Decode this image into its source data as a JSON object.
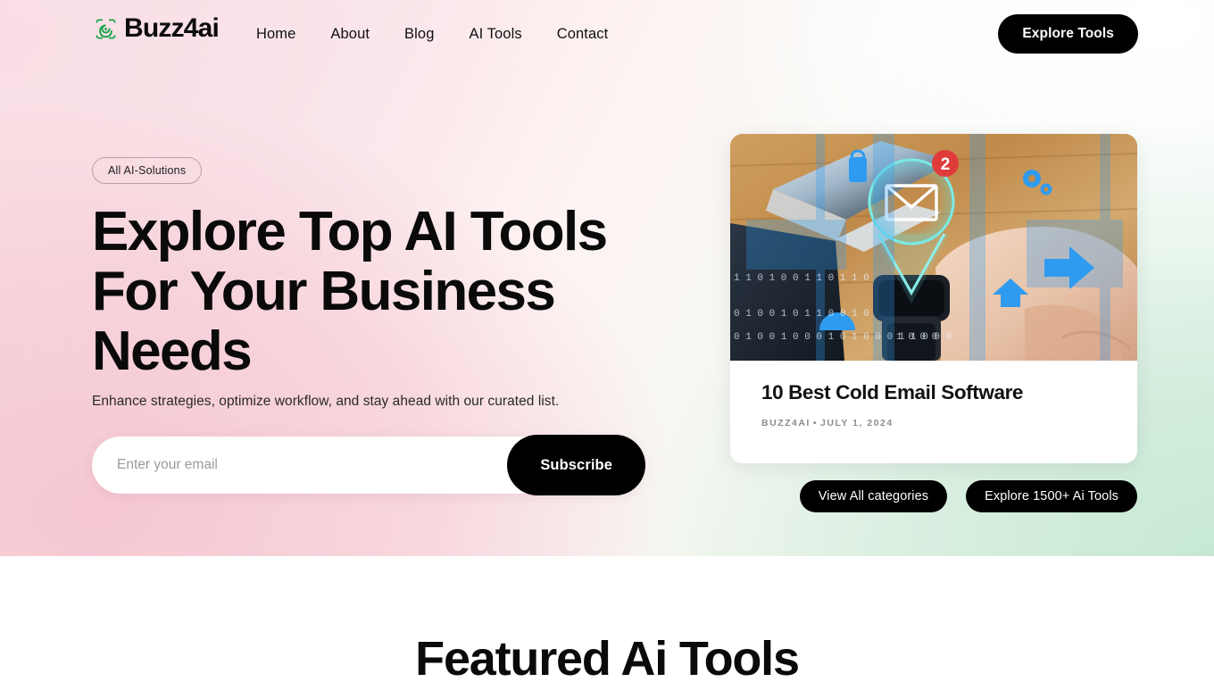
{
  "header": {
    "brand": {
      "name": "Buzz4ai",
      "logo_icon": "spiral-logo-icon",
      "logo_color": "#16a34a"
    },
    "nav": [
      {
        "label": "Home"
      },
      {
        "label": "About"
      },
      {
        "label": "Blog"
      },
      {
        "label": "AI Tools"
      },
      {
        "label": "Contact"
      }
    ],
    "cta": {
      "label": "Explore Tools"
    }
  },
  "hero": {
    "badge": "All AI-Solutions",
    "headline": "Explore Top AI Tools For Your Business Needs",
    "subheadline": "Enhance strategies, optimize workflow, and stay ahead with our curated list.",
    "subscribe": {
      "placeholder": "Enter your email",
      "value": "",
      "button_label": "Subscribe"
    },
    "card": {
      "image_alt": "smartwatch-email-notification-image",
      "badge_count": "2",
      "title": "10 Best Cold Email Software",
      "author": "BUZZ4AI",
      "separator": "•",
      "date": "JULY 1, 2024"
    },
    "actions": [
      {
        "label": "View All categories"
      },
      {
        "label": "Explore 1500+ Ai Tools"
      }
    ],
    "colors": {
      "pink": "#f6cdd6",
      "mint": "#d6eedf",
      "accent_black": "#000000",
      "brand_green": "#16a34a",
      "badge_red": "#e03b3b"
    }
  },
  "featured": {
    "title": "Featured Ai Tools"
  }
}
